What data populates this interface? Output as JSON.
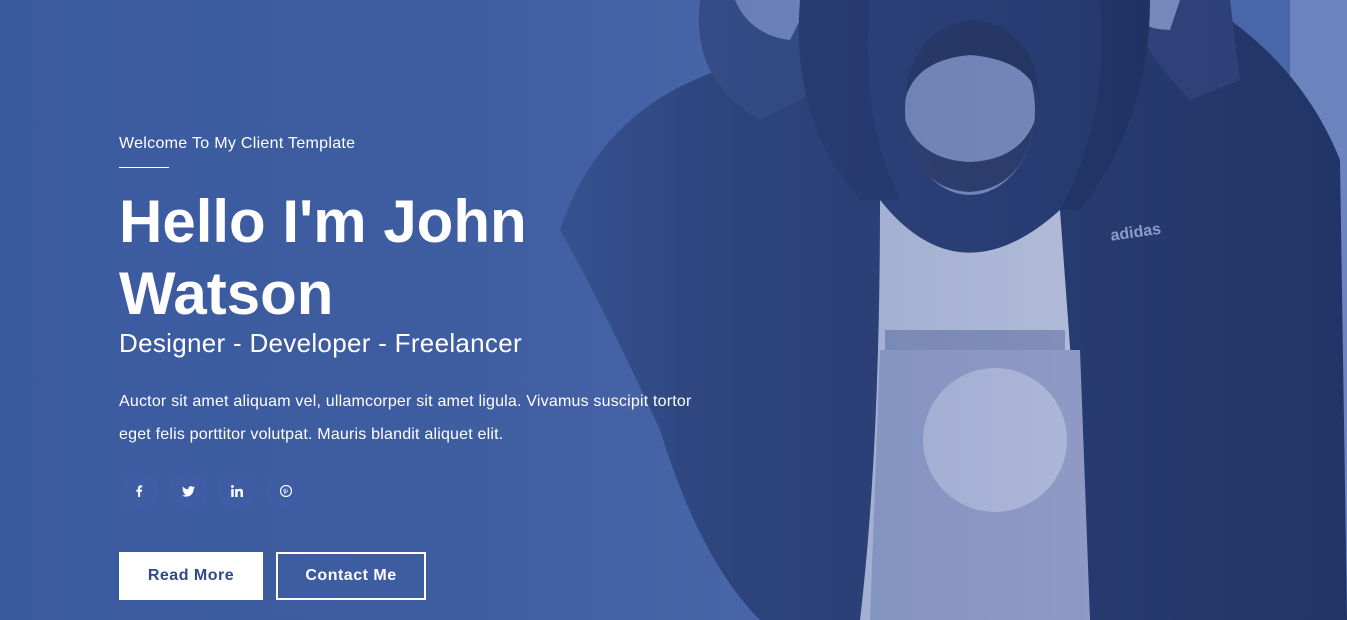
{
  "hero": {
    "kicker": "Welcome To My Client Template",
    "title": "Hello I'm John Watson",
    "subtitle": "Designer - Developer - Freelancer",
    "description": "Auctor sit amet aliquam vel, ullamcorper sit amet ligula. Vivamus suscipit tortor eget felis porttitor volutpat. Mauris blandit aliquet elit.",
    "socials": [
      {
        "icon": "facebook-icon",
        "glyph": "f"
      },
      {
        "icon": "twitter-icon",
        "glyph": "t"
      },
      {
        "icon": "linkedin-icon",
        "glyph": "in"
      },
      {
        "icon": "pinterest-icon",
        "glyph": "p"
      }
    ],
    "buttons": {
      "read_more": "Read More",
      "contact": "Contact Me"
    },
    "colors": {
      "overlay": "#3a5aa0",
      "social_bg": "#3e5da5",
      "button_text": "#2e4a8c",
      "text": "#ffffff"
    }
  }
}
